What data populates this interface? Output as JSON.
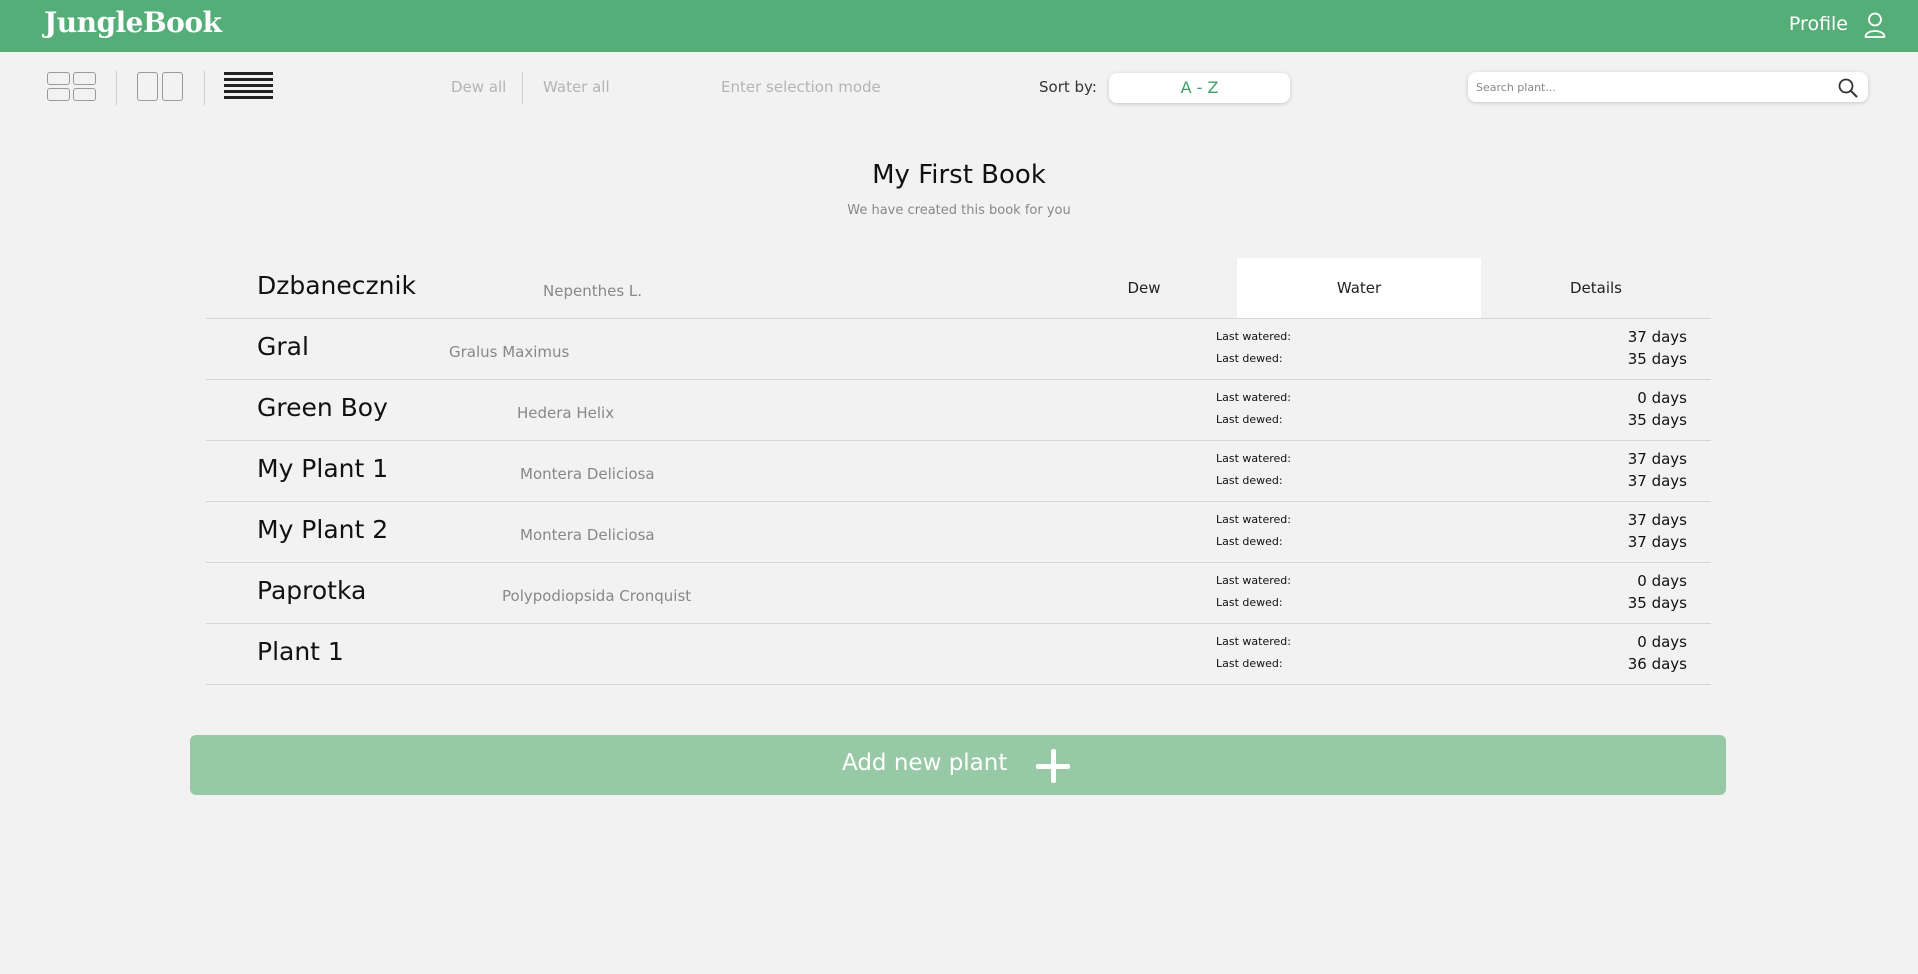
{
  "header": {
    "logo": "JungleBook",
    "profile_label": "Profile",
    "profile_icon": "user-icon"
  },
  "toolbar": {
    "view_modes": [
      "grid-view-icon",
      "split-view-icon",
      "list-view-icon"
    ],
    "active_view": "list",
    "dew_all": "Dew all",
    "water_all": "Water all",
    "selection_mode": "Enter selection mode",
    "sort_label": "Sort by:",
    "sort_value": "A - Z",
    "search_placeholder": "Search plant...",
    "search_icon": "search-icon"
  },
  "book": {
    "title": "My First Book",
    "subtitle": "We have created this book for you"
  },
  "plants": [
    {
      "name": "Dzbanecznik",
      "species": "Nepenthes L.",
      "expanded": true,
      "actions": {
        "dew": "Dew",
        "water": "Water",
        "details": "Details"
      }
    },
    {
      "name": "Gral",
      "species": "Gralus Maximus",
      "watered_label": "Last watered:",
      "dewed_label": "Last dewed:",
      "watered": "37 days",
      "dewed": "35 days"
    },
    {
      "name": "Green Boy",
      "species": "Hedera Helix",
      "watered_label": "Last watered:",
      "dewed_label": "Last dewed:",
      "watered": "0 days",
      "dewed": "35 days"
    },
    {
      "name": "My Plant 1",
      "species": "Montera Deliciosa",
      "watered_label": "Last watered:",
      "dewed_label": "Last dewed:",
      "watered": "37 days",
      "dewed": "37 days"
    },
    {
      "name": "My Plant 2",
      "species": "Montera Deliciosa",
      "watered_label": "Last watered:",
      "dewed_label": "Last dewed:",
      "watered": "37 days",
      "dewed": "37 days"
    },
    {
      "name": "Paprotka",
      "species": "Polypodiopsida Cronquist",
      "watered_label": "Last watered:",
      "dewed_label": "Last dewed:",
      "watered": "0 days",
      "dewed": "35 days"
    },
    {
      "name": "Plant 1",
      "species": "",
      "watered_label": "Last watered:",
      "dewed_label": "Last dewed:",
      "watered": "0 days",
      "dewed": "36 days"
    }
  ],
  "add_button": {
    "label": "Add new plant",
    "icon": "plus-icon"
  },
  "colors": {
    "brand_green": "#55ae78",
    "add_button": "#97c9a7",
    "sort_text": "#3ea064",
    "background": "#f2f2f2"
  }
}
